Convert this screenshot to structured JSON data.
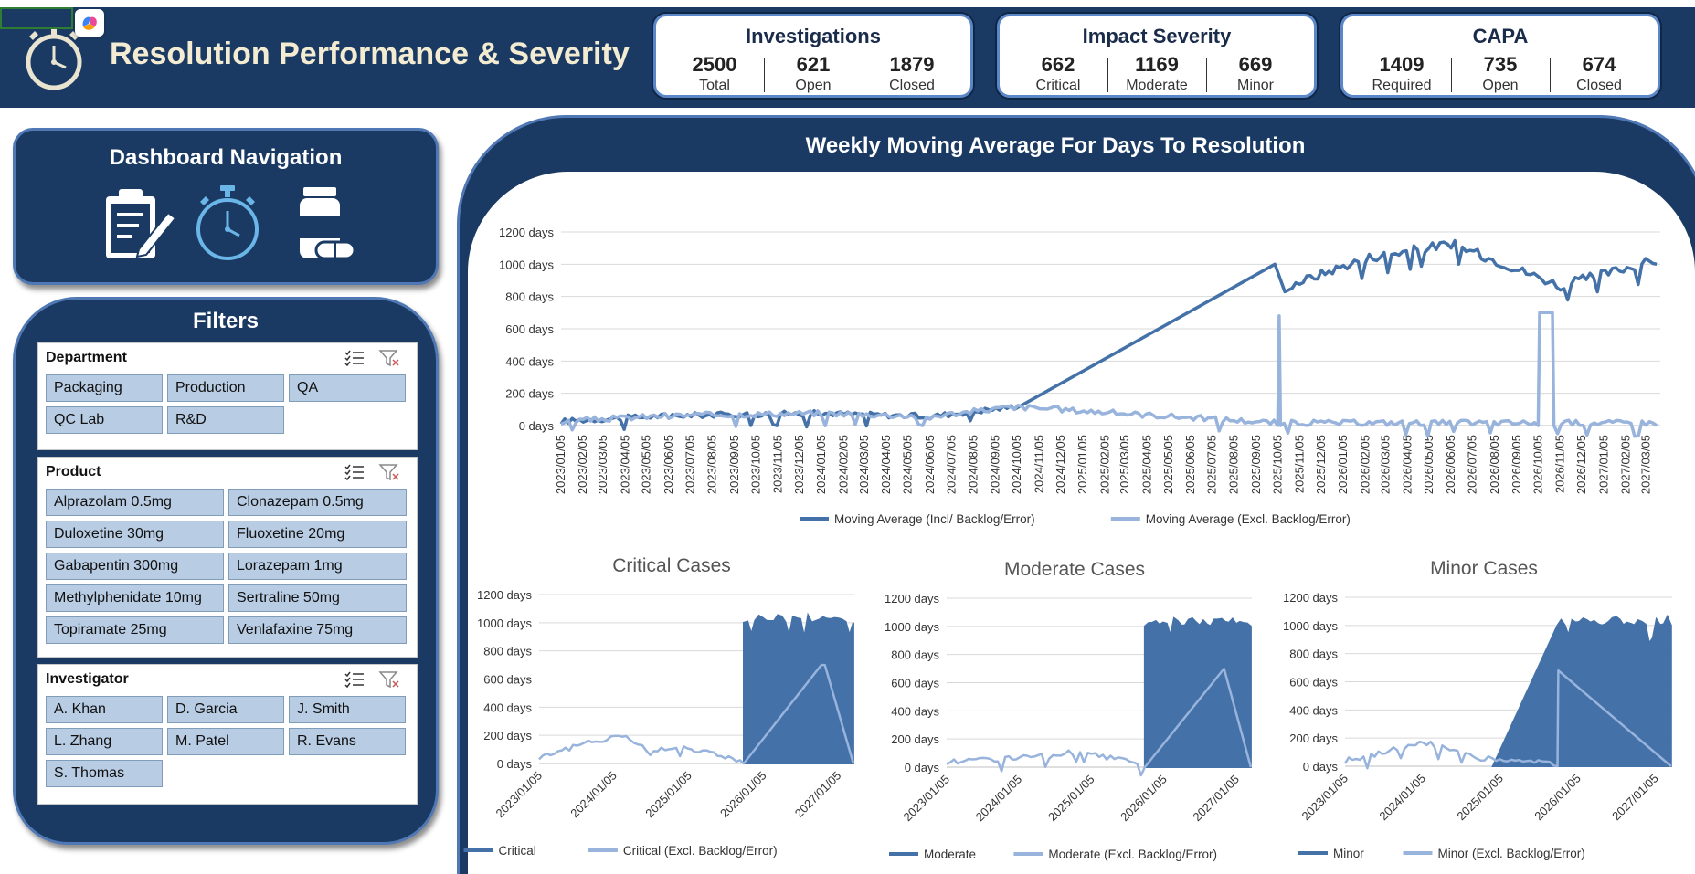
{
  "header": {
    "title": "Resolution Performance & Severity"
  },
  "kpis": [
    {
      "title": "Investigations",
      "items": [
        {
          "value": "2500",
          "label": "Total"
        },
        {
          "value": "621",
          "label": "Open"
        },
        {
          "value": "1879",
          "label": "Closed"
        }
      ]
    },
    {
      "title": "Impact Severity",
      "items": [
        {
          "value": "662",
          "label": "Critical"
        },
        {
          "value": "1169",
          "label": "Moderate"
        },
        {
          "value": "669",
          "label": "Minor"
        }
      ]
    },
    {
      "title": "CAPA",
      "items": [
        {
          "value": "1409",
          "label": "Required"
        },
        {
          "value": "735",
          "label": "Open"
        },
        {
          "value": "674",
          "label": "Closed"
        }
      ]
    }
  ],
  "navigation": {
    "title": "Dashboard Navigation",
    "icons": [
      "clipboard-pencil-icon",
      "stopwatch-icon",
      "pill-bottle-icon"
    ]
  },
  "filters": {
    "title": "Filters",
    "slicers": [
      {
        "name": "Department",
        "items": [
          "Packaging",
          "Production",
          "QA",
          "QC Lab",
          "R&D"
        ]
      },
      {
        "name": "Product",
        "items": [
          "Alprazolam 0.5mg",
          "Clonazepam 0.5mg",
          "Duloxetine 30mg",
          "Fluoxetine 20mg",
          "Gabapentin 300mg",
          "Lorazepam 1mg",
          "Methylphenidate 10mg",
          "Sertraline 50mg",
          "Topiramate 25mg",
          "Venlafaxine 75mg"
        ]
      },
      {
        "name": "Investigator",
        "items": [
          "A. Khan",
          "D. Garcia",
          "J. Smith",
          "L. Zhang",
          "M. Patel",
          "R. Evans",
          "S. Thomas"
        ]
      }
    ]
  },
  "colors": {
    "navy": "#1a3a63",
    "series_dark": "#4472a8",
    "series_light": "#98b3dc",
    "header_text": "#f3ecd2"
  },
  "chart_data": [
    {
      "type": "line",
      "title": "Weekly Moving Average For Days To Resolution",
      "x_tick_labels": [
        "2023/01/05",
        "2023/02/05",
        "2023/03/05",
        "2023/04/05",
        "2023/05/05",
        "2023/06/05",
        "2023/07/05",
        "2023/08/05",
        "2023/09/05",
        "2023/10/05",
        "2023/11/05",
        "2023/12/05",
        "2024/01/05",
        "2024/02/05",
        "2024/03/05",
        "2024/04/05",
        "2024/05/05",
        "2024/06/05",
        "2024/07/05",
        "2024/08/05",
        "2024/09/05",
        "2024/10/05",
        "2024/11/05",
        "2024/12/05",
        "2025/01/05",
        "2025/02/05",
        "2025/03/05",
        "2025/04/05",
        "2025/05/05",
        "2025/06/05",
        "2025/07/05",
        "2025/08/05",
        "2025/09/05",
        "2025/10/05",
        "2025/11/05",
        "2025/12/05",
        "2026/01/05",
        "2026/02/05",
        "2026/03/05",
        "2026/04/05",
        "2026/05/05",
        "2026/06/05",
        "2026/07/05",
        "2026/08/05",
        "2026/09/05",
        "2026/10/05",
        "2026/11/05",
        "2026/12/05",
        "2027/01/05",
        "2027/02/05",
        "2027/03/05"
      ],
      "y_ticks": [
        "0 days",
        "200 days",
        "400 days",
        "600 days",
        "800 days",
        "1000 days",
        "1200 days"
      ],
      "ylim": [
        0,
        1200
      ],
      "grid": true,
      "legend": "bottom",
      "series": [
        {
          "name": "Moving Average (Incl/ Backlog/Error)",
          "x": [
            "2023/01/05",
            "2023/06/05",
            "2024/01/05",
            "2024/06/05",
            "2024/10/01",
            "2025/10/01",
            "2025/10/15",
            "2026/02/05",
            "2026/06/05",
            "2026/11/05",
            "2027/03/20"
          ],
          "y": [
            10,
            45,
            60,
            40,
            100,
            1000,
            830,
            1010,
            1100,
            840,
            1000
          ]
        },
        {
          "name": "Moving Average (Excl. Backlog/Error)",
          "x": [
            "2023/01/05",
            "2023/06/05",
            "2024/01/05",
            "2024/06/05",
            "2024/10/01",
            "2025/10/05",
            "2025/10/07",
            "2025/10/09",
            "2026/10/05",
            "2026/10/07",
            "2026/10/25",
            "2026/10/27",
            "2027/03/20"
          ],
          "y": [
            10,
            45,
            60,
            40,
            100,
            0,
            680,
            0,
            0,
            700,
            700,
            0,
            0
          ]
        }
      ]
    },
    {
      "type": "area",
      "title": "Critical Cases",
      "x_tick_labels": [
        "2023/01/05",
        "2024/01/05",
        "2025/01/05",
        "2026/01/05",
        "2027/01/05"
      ],
      "y_ticks": [
        "0 days",
        "200 days",
        "400 days",
        "600 days",
        "800 days",
        "1000 days",
        "1200 days"
      ],
      "ylim": [
        0,
        1200
      ],
      "legend": "bottom",
      "series": [
        {
          "name": "Critical",
          "x": [
            "2025/10/01",
            "2027/03/20"
          ],
          "y": [
            1000,
            1000
          ]
        },
        {
          "name": "Critical (Excl. Backlog/Error)",
          "x": [
            "2023/01/05",
            "2024/02/15",
            "2024/07/01",
            "2024/11/05",
            "2025/10/01",
            "2026/10/15",
            "2026/11/01",
            "2027/03/20"
          ],
          "y": [
            30,
            190,
            60,
            110,
            0,
            700,
            700,
            0
          ]
        }
      ]
    },
    {
      "type": "area",
      "title": "Moderate Cases",
      "x_tick_labels": [
        "2023/01/05",
        "2024/01/05",
        "2025/01/05",
        "2026/01/05",
        "2027/01/05"
      ],
      "y_ticks": [
        "0 days",
        "200 days",
        "400 days",
        "600 days",
        "800 days",
        "1000 days",
        "1200 days"
      ],
      "ylim": [
        0,
        1200
      ],
      "legend": "bottom",
      "series": [
        {
          "name": "Moderate",
          "x": [
            "2025/10/01",
            "2027/03/20"
          ],
          "y": [
            1000,
            1000
          ]
        },
        {
          "name": "Moderate (Excl. Backlog/Error)",
          "x": [
            "2023/01/05",
            "2024/06/05",
            "2024/10/01",
            "2025/10/01",
            "2026/11/05",
            "2027/03/20"
          ],
          "y": [
            20,
            60,
            90,
            0,
            700,
            0
          ]
        }
      ]
    },
    {
      "type": "area",
      "title": "Minor Cases",
      "x_tick_labels": [
        "2023/01/05",
        "2024/01/05",
        "2025/01/05",
        "2026/01/05",
        "2027/01/05"
      ],
      "y_ticks": [
        "0 days",
        "200 days",
        "400 days",
        "600 days",
        "800 days",
        "1000 days",
        "1200 days"
      ],
      "ylim": [
        0,
        1200
      ],
      "legend": "bottom",
      "series": [
        {
          "name": "Minor",
          "x": [
            "2024/12/01",
            "2025/10/01",
            "2027/03/20"
          ],
          "y": [
            0,
            1000,
            1000
          ]
        },
        {
          "name": "Minor (Excl. Backlog/Error)",
          "x": [
            "2023/01/05",
            "2024/01/25",
            "2024/10/05",
            "2025/10/01",
            "2025/10/05",
            "2027/03/20"
          ],
          "y": [
            20,
            150,
            40,
            0,
            680,
            0
          ]
        }
      ]
    }
  ]
}
